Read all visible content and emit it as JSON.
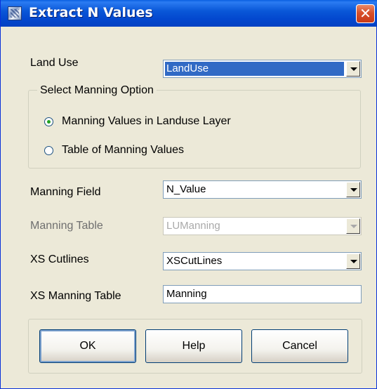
{
  "window": {
    "title": "Extract N Values",
    "close_glyph": "✕",
    "icon": "app-icon"
  },
  "fields": {
    "land_use": {
      "label": "Land Use",
      "value": "LandUse"
    },
    "group": {
      "title": "Select Manning Option",
      "option1": "Manning Values in Landuse Layer",
      "option2": "Table of Manning Values",
      "selected": "option1"
    },
    "manning_field": {
      "label": "Manning Field",
      "value": "N_Value"
    },
    "manning_table": {
      "label": "Manning Table",
      "value": "LUManning",
      "enabled": false
    },
    "xs_cutlines": {
      "label": "XS Cutlines",
      "value": "XSCutLines"
    },
    "xs_manning_table": {
      "label": "XS Manning Table",
      "value": "Manning"
    }
  },
  "buttons": {
    "ok": "OK",
    "help": "Help",
    "cancel": "Cancel"
  },
  "colors": {
    "titlebar": "#0348cf",
    "dialog_bg": "#ece9d8",
    "selection": "#316ac5",
    "close": "#d8502a"
  }
}
